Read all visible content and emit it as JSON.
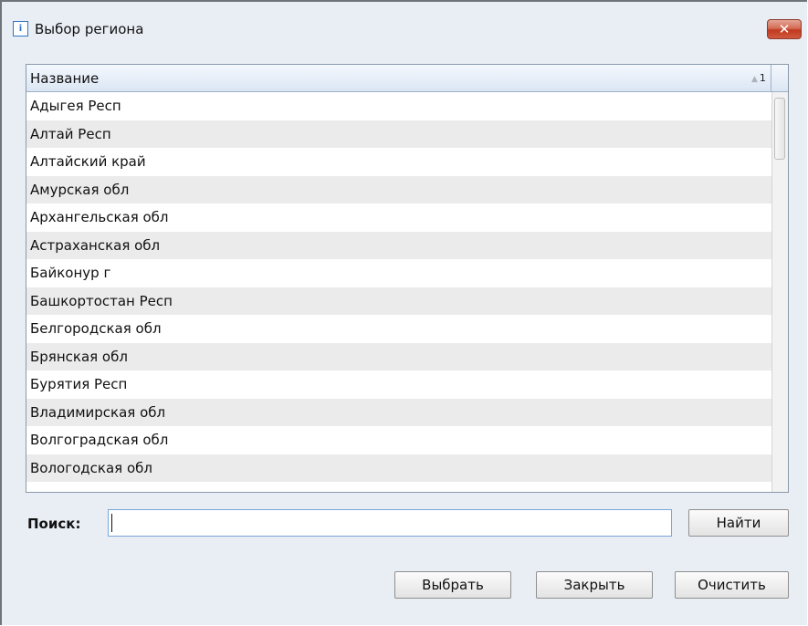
{
  "window": {
    "title": "Выбор региона",
    "app_icon": "app-icon",
    "close_label": "✕"
  },
  "table": {
    "column_header": "Название",
    "sort_order": "1",
    "rows": [
      "Адыгея Респ",
      "Алтай Респ",
      "Алтайский край",
      "Амурская обл",
      "Архангельская обл",
      "Астраханская обл",
      "Байконур г",
      "Башкортостан Респ",
      "Белгородская обл",
      "Брянская обл",
      "Бурятия Респ",
      "Владимирская обл",
      "Волгоградская обл",
      "Вологодская обл"
    ]
  },
  "search": {
    "label": "Поиск:",
    "value": "",
    "find_button": "Найти"
  },
  "buttons": {
    "select": "Выбрать",
    "close": "Закрыть",
    "clear": "Очистить"
  }
}
